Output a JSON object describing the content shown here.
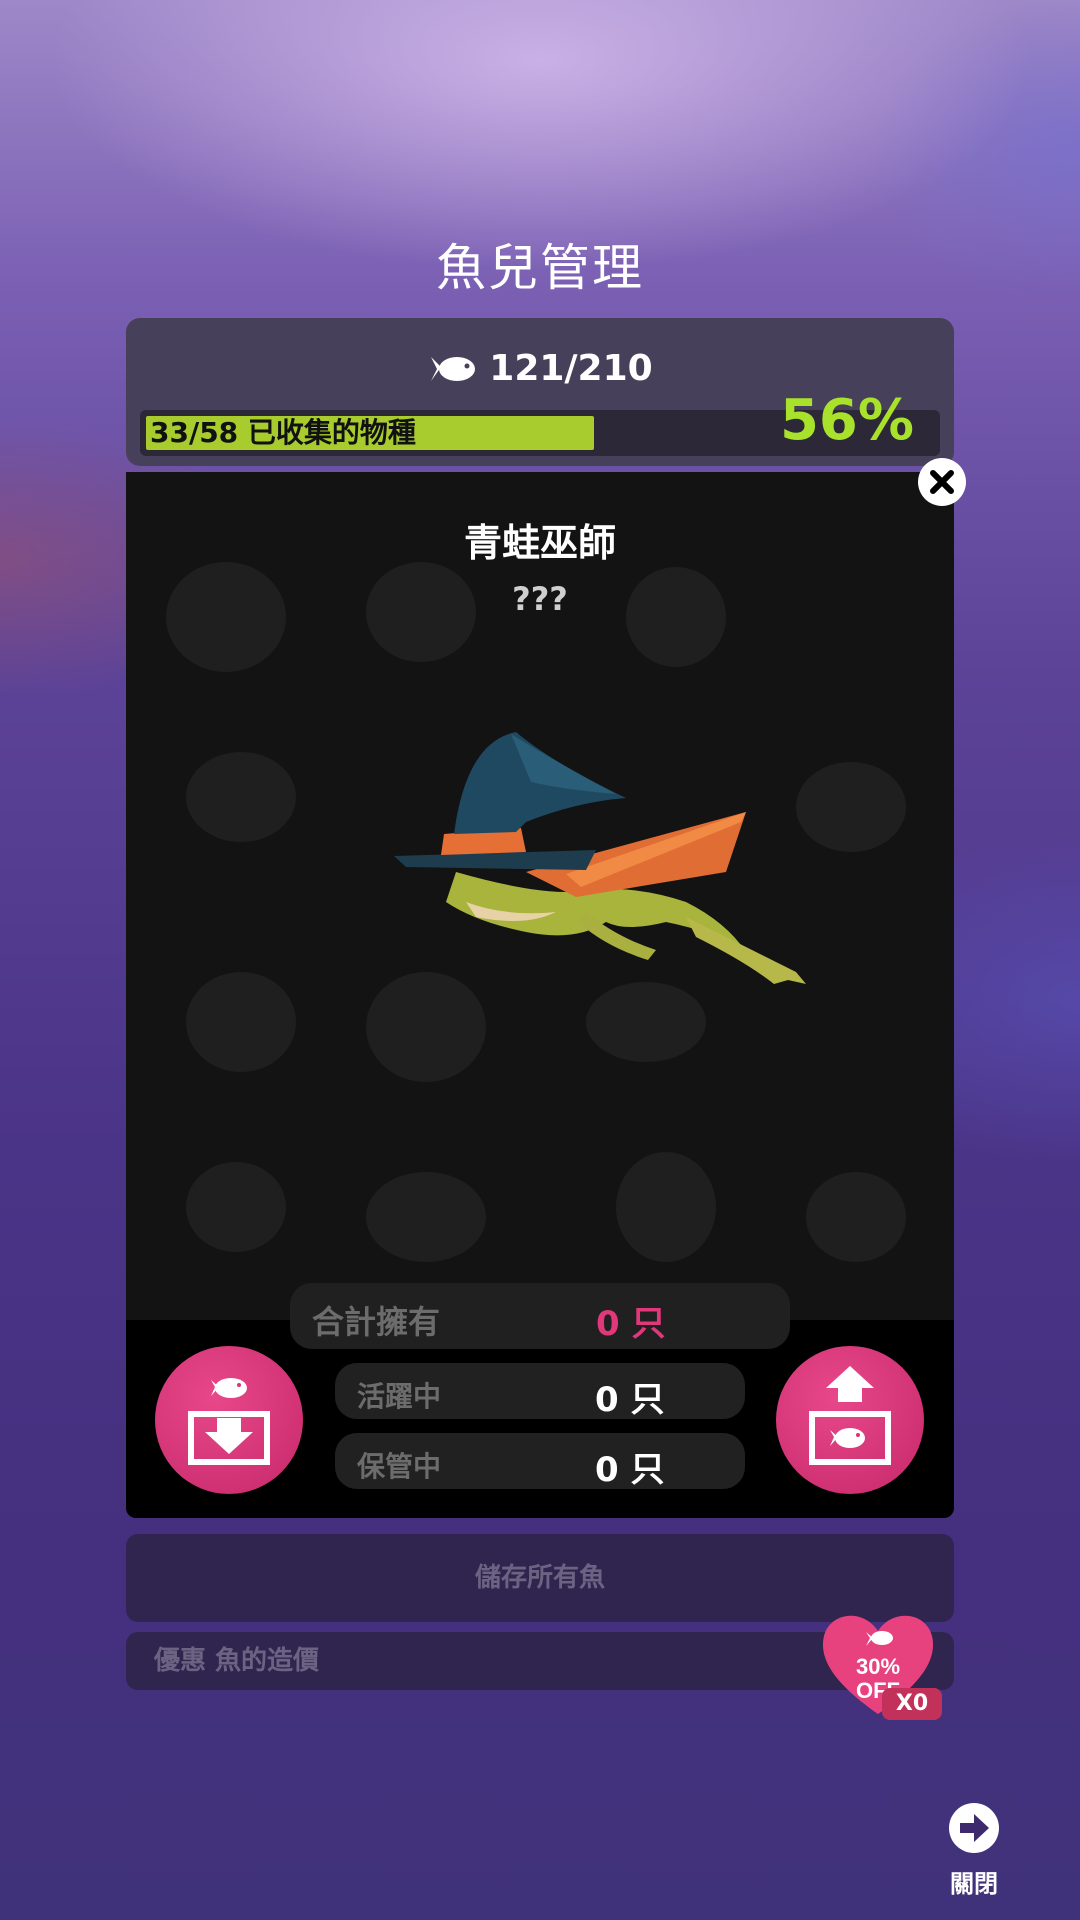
{
  "header": {
    "title": "魚兒管理"
  },
  "stats": {
    "fish_count": "121/210",
    "species_label": "33/58 已收集的物種",
    "species_fraction": 0.569,
    "percent": "56%"
  },
  "detail": {
    "name": "青蛙巫師",
    "subtitle": "???",
    "total_label": "合計擁有",
    "total_value": "0 只",
    "active_label": "活躍中",
    "active_value": "0 只",
    "stored_label": "保管中",
    "stored_value": "0 只"
  },
  "actions": {
    "save_all_label": "儲存所有魚",
    "discount_label": "優惠 魚的造價",
    "discount_badge": "30%",
    "discount_off": "OFF",
    "discount_count": "X0"
  },
  "footer": {
    "close_label": "關閉"
  },
  "colors": {
    "accent_pink": "#e0387a",
    "progress_green": "#a8cc2e",
    "percent_green": "#a8e22a"
  }
}
